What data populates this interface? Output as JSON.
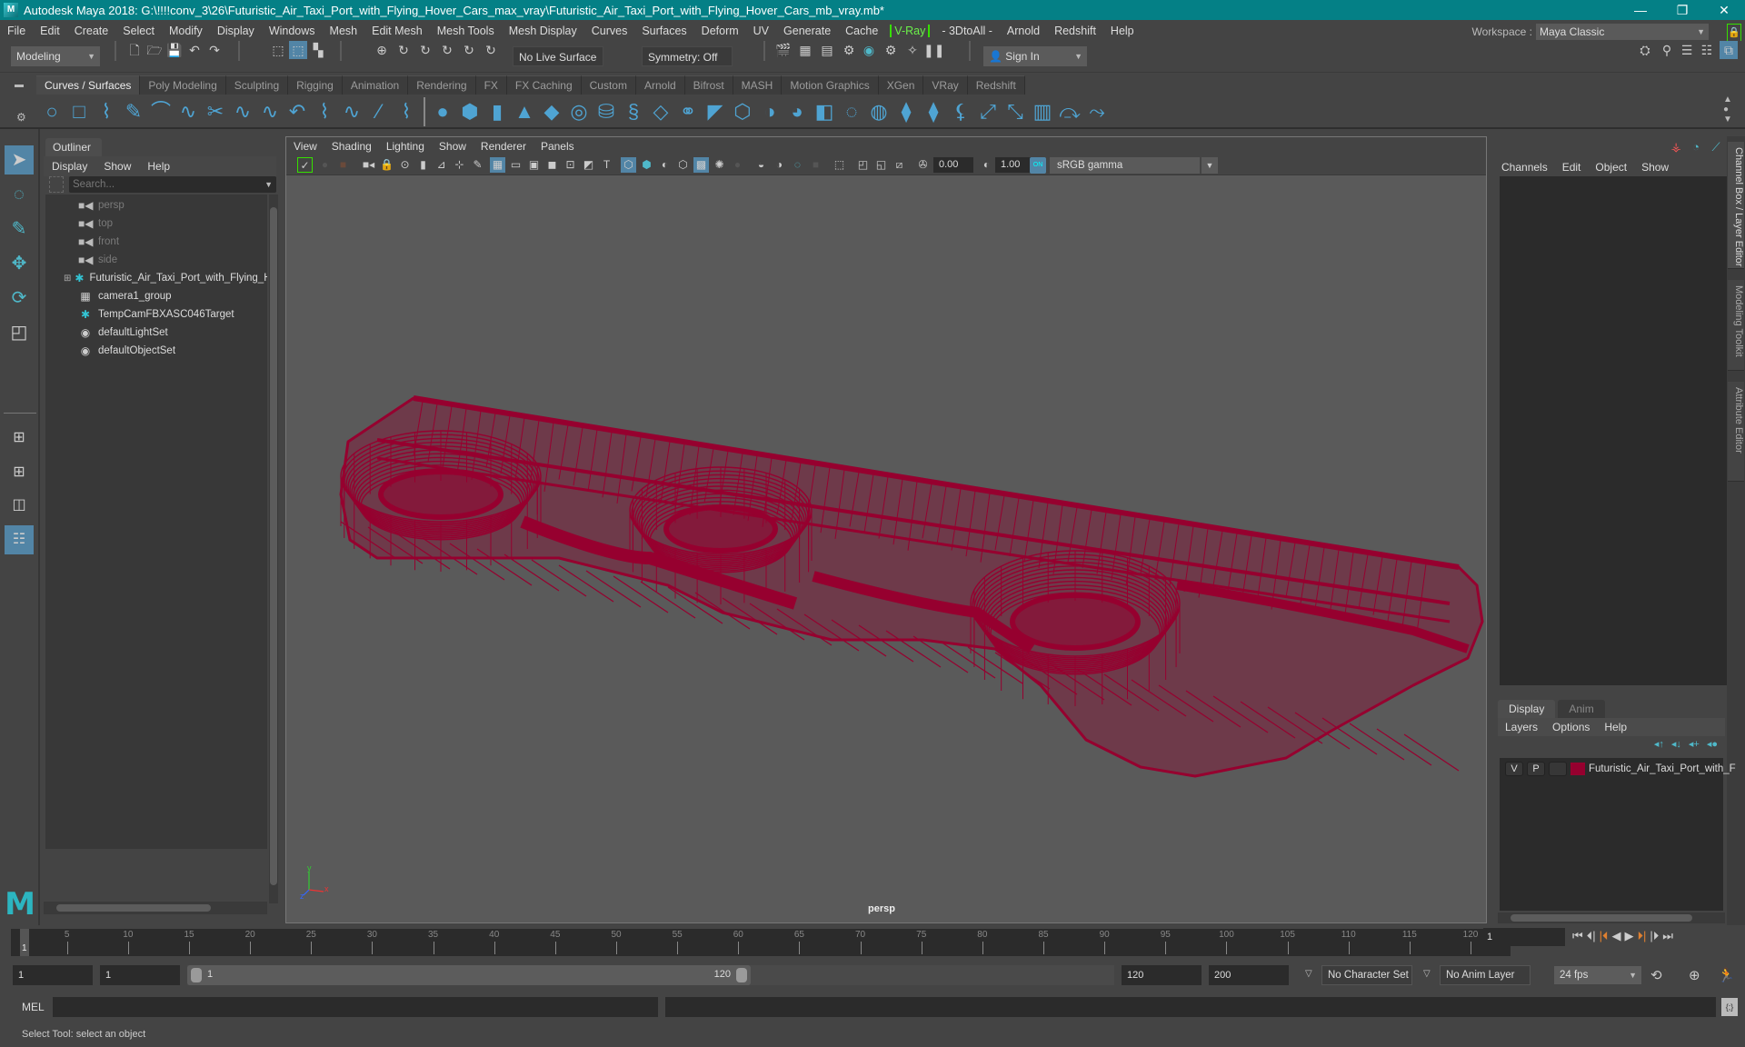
{
  "window": {
    "title": "Autodesk Maya 2018: G:\\!!!!conv_3\\26\\Futuristic_Air_Taxi_Port_with_Flying_Hover_Cars_max_vray\\Futuristic_Air_Taxi_Port_with_Flying_Hover_Cars_mb_vray.mb*",
    "logo": "M",
    "minimize": "—",
    "maximize": "❐",
    "close": "✕"
  },
  "menubar": {
    "items": [
      "File",
      "Edit",
      "Create",
      "Select",
      "Modify",
      "Display",
      "Windows",
      "Mesh",
      "Edit Mesh",
      "Mesh Tools",
      "Mesh Display",
      "Curves",
      "Surfaces",
      "Deform",
      "UV",
      "Generate",
      "Cache",
      "V-Ray",
      "- 3DtoAll -",
      "Arnold",
      "Redshift",
      "Help"
    ],
    "workspace_label": "Workspace :",
    "workspace_value": "Maya Classic"
  },
  "statusline": {
    "mode": "Modeling",
    "live_surface": "No Live Surface",
    "symmetry": "Symmetry: Off",
    "sign_in": "Sign In"
  },
  "shelf": {
    "tabs": [
      "Curves / Surfaces",
      "Poly Modeling",
      "Sculpting",
      "Rigging",
      "Animation",
      "Rendering",
      "FX",
      "FX Caching",
      "Custom",
      "Arnold",
      "Bifrost",
      "MASH",
      "Motion Graphics",
      "XGen",
      "VRay",
      "Redshift"
    ],
    "active_tab": 0,
    "curve_icons": [
      "○",
      "□",
      "⌇",
      "✎",
      "⌒",
      "∿",
      "✂",
      "∿",
      "∿",
      "↶",
      "⌇",
      "∿",
      "⁄",
      "⌇"
    ],
    "surface_icons": [
      "●",
      "⬢",
      "▮",
      "▲",
      "◆",
      "◎",
      "⛁",
      "§",
      "◇",
      "⚭",
      "◤",
      "⬡",
      "◑",
      "◕",
      "◧",
      "◌",
      "◍",
      "⧫",
      "⧫",
      "⚸",
      "⤢",
      "⤡",
      "▥",
      "⤼",
      "⤳"
    ]
  },
  "outliner": {
    "title": "Outliner",
    "menu": [
      "Display",
      "Show",
      "Help"
    ],
    "search_placeholder": "Search...",
    "items": [
      {
        "label": "persp",
        "icon": "camera-icon",
        "glyph": "■◀",
        "type": "camera"
      },
      {
        "label": "top",
        "icon": "camera-icon",
        "glyph": "■◀",
        "type": "camera"
      },
      {
        "label": "front",
        "icon": "camera-icon",
        "glyph": "■◀",
        "type": "camera"
      },
      {
        "label": "side",
        "icon": "camera-icon",
        "glyph": "■◀",
        "type": "camera"
      },
      {
        "label": "Futuristic_Air_Taxi_Port_with_Flying_H",
        "icon": "locator-icon",
        "glyph": "✱",
        "type": "group",
        "expand": "⊞"
      },
      {
        "label": "camera1_group",
        "icon": "group-icon",
        "glyph": "▦",
        "type": "node"
      },
      {
        "label": "TempCamFBXASC046Target",
        "icon": "locator-icon",
        "glyph": "✱",
        "type": "node"
      },
      {
        "label": "defaultLightSet",
        "icon": "set-icon",
        "glyph": "◉",
        "type": "set"
      },
      {
        "label": "defaultObjectSet",
        "icon": "set-icon",
        "glyph": "◉",
        "type": "set"
      }
    ]
  },
  "viewport": {
    "menu": [
      "View",
      "Shading",
      "Lighting",
      "Show",
      "Renderer",
      "Panels"
    ],
    "exposure": "0.00",
    "gamma": "1.00",
    "color_management_on": "ON",
    "colorspace": "sRGB gamma",
    "camera_label": "persp",
    "axis": {
      "x": "x",
      "y": "y",
      "z": "z"
    },
    "wireframe_color": "#96002f"
  },
  "channelbox": {
    "menu": [
      "Channels",
      "Edit",
      "Object",
      "Show"
    ],
    "side_tabs": [
      "Channel Box / Layer Editor",
      "Modeling Toolkit",
      "Attribute Editor"
    ]
  },
  "layereditor": {
    "tabs": [
      "Display",
      "Anim"
    ],
    "menu": [
      "Layers",
      "Options",
      "Help"
    ],
    "layers": [
      {
        "v": "V",
        "p": "P",
        "color": "#96002f",
        "name": "Futuristic_Air_Taxi_Port_with_F"
      }
    ]
  },
  "timeslider": {
    "ticks": [
      5,
      10,
      15,
      20,
      25,
      30,
      35,
      40,
      45,
      50,
      55,
      60,
      65,
      70,
      75,
      80,
      85,
      90,
      95,
      100,
      105,
      110,
      115,
      120
    ],
    "range": [
      1,
      120
    ],
    "current_frame": "1",
    "current_frame_field": "1"
  },
  "rangeslider": {
    "start_time": "1",
    "playback_start": "1",
    "range_start": "1",
    "range_end": "120",
    "playback_end": "120",
    "end_time": "200",
    "character_set": "No Character Set",
    "anim_layer": "No Anim Layer",
    "fps": "24 fps"
  },
  "cmdline": {
    "label": "MEL"
  },
  "helpline": {
    "text": "Select Tool: select an object"
  }
}
